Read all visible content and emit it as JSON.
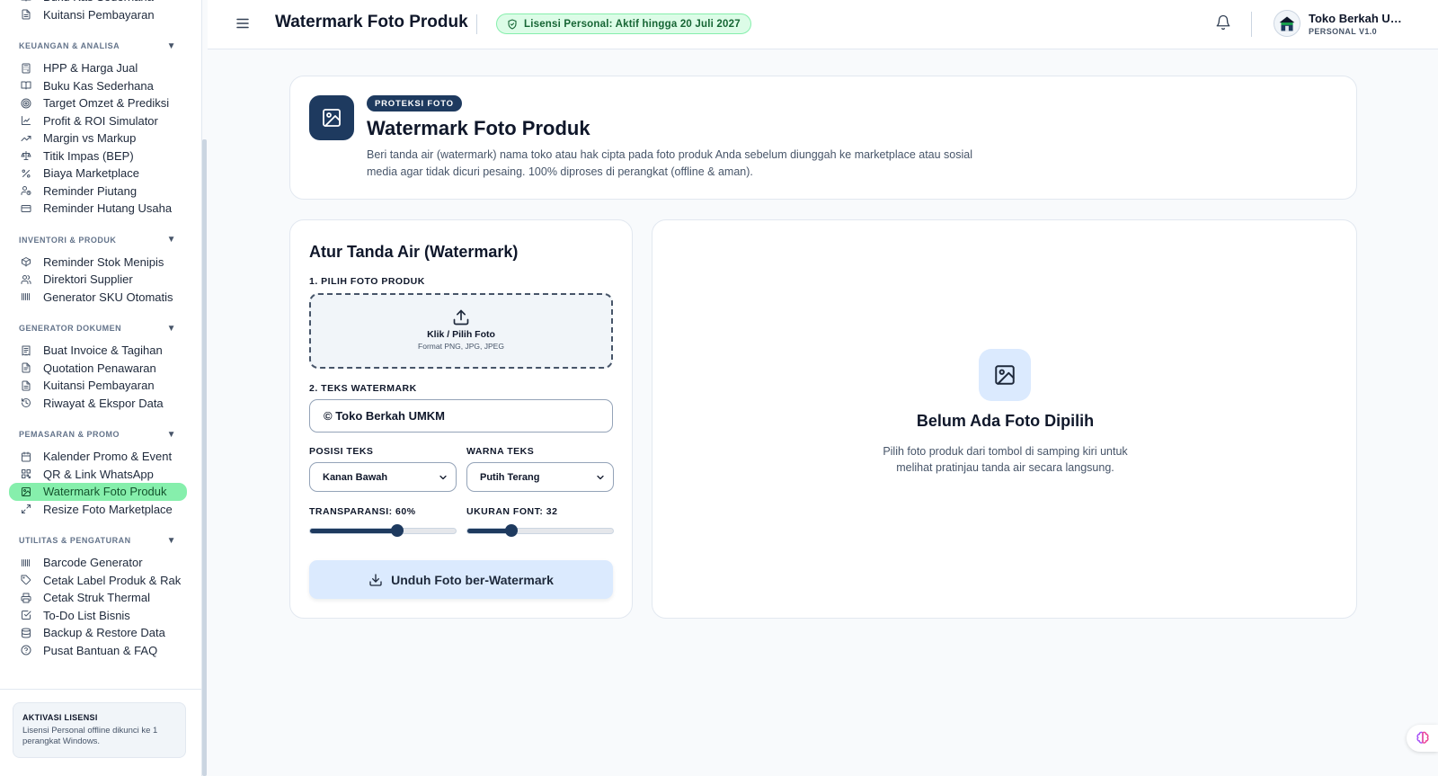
{
  "sidebar": {
    "top_items": [
      {
        "label": "Buku Kas Sederhana",
        "icon": "book-open-icon"
      },
      {
        "label": "Kuitansi Pembayaran",
        "icon": "file-text-icon"
      }
    ],
    "sections": [
      {
        "title": "KEUANGAN & ANALISA",
        "items": [
          {
            "label": "HPP & Harga Jual",
            "icon": "calculator-icon"
          },
          {
            "label": "Buku Kas Sederhana",
            "icon": "book-open-icon"
          },
          {
            "label": "Target Omzet & Prediksi",
            "icon": "target-icon"
          },
          {
            "label": "Profit & ROI Simulator",
            "icon": "line-chart-icon"
          },
          {
            "label": "Margin vs Markup",
            "icon": "trending-up-icon"
          },
          {
            "label": "Titik Impas (BEP)",
            "icon": "scale-icon"
          },
          {
            "label": "Biaya Marketplace",
            "icon": "percent-icon"
          },
          {
            "label": "Reminder Piutang",
            "icon": "user-clock-icon"
          },
          {
            "label": "Reminder Hutang Usaha",
            "icon": "credit-card-icon"
          }
        ]
      },
      {
        "title": "INVENTORI & PRODUK",
        "items": [
          {
            "label": "Reminder Stok Menipis",
            "icon": "package-icon"
          },
          {
            "label": "Direktori Supplier",
            "icon": "users-icon"
          },
          {
            "label": "Generator SKU Otomatis",
            "icon": "barcode-icon"
          }
        ]
      },
      {
        "title": "GENERATOR DOKUMEN",
        "items": [
          {
            "label": "Buat Invoice & Tagihan",
            "icon": "invoice-icon"
          },
          {
            "label": "Quotation Penawaran",
            "icon": "file-list-icon"
          },
          {
            "label": "Kuitansi Pembayaran",
            "icon": "file-text-icon"
          },
          {
            "label": "Riwayat & Ekspor Data",
            "icon": "history-icon"
          }
        ]
      },
      {
        "title": "PEMASARAN & PROMO",
        "items": [
          {
            "label": "Kalender Promo & Event",
            "icon": "calendar-icon"
          },
          {
            "label": "QR & Link WhatsApp",
            "icon": "qr-code-icon"
          },
          {
            "label": "Watermark Foto Produk",
            "icon": "image-icon",
            "active": true
          },
          {
            "label": "Resize Foto Marketplace",
            "icon": "maximize-icon"
          }
        ]
      },
      {
        "title": "UTILITAS & PENGATURAN",
        "items": [
          {
            "label": "Barcode Generator",
            "icon": "barcode-icon"
          },
          {
            "label": "Cetak Label Produk & Rak",
            "icon": "tag-icon"
          },
          {
            "label": "Cetak Struk Thermal",
            "icon": "printer-icon"
          },
          {
            "label": "To-Do List Bisnis",
            "icon": "check-square-icon"
          },
          {
            "label": "Backup & Restore Data",
            "icon": "database-icon"
          },
          {
            "label": "Pusat Bantuan & FAQ",
            "icon": "help-circle-icon"
          }
        ]
      }
    ],
    "license": {
      "title": "AKTIVASI LISENSI",
      "desc": "Lisensi Personal offline dikunci ke 1 perangkat Windows."
    }
  },
  "topbar": {
    "title": "Watermark Foto Produk",
    "license_badge": "Lisensi Personal: Aktif hingga 20 Juli 2027",
    "shop_name": "Toko Berkah UMKM",
    "plan": "PERSONAL V1.0"
  },
  "hero": {
    "tag": "PROTEKSI FOTO",
    "title": "Watermark Foto Produk",
    "desc": "Beri tanda air (watermark) nama toko atau hak cipta pada foto produk Anda sebelum diunggah ke marketplace atau sosial media agar tidak dicuri pesaing. 100% diproses di perangkat (offline & aman)."
  },
  "form": {
    "title": "Atur Tanda Air (Watermark)",
    "step1_label": "1. PILIH FOTO PRODUK",
    "upload_title": "Klik / Pilih Foto",
    "upload_formats": "Format PNG, JPG, JPEG",
    "step2_label": "2. TEKS WATERMARK",
    "watermark_value": "© Toko Berkah UMKM",
    "position_label": "POSISI TEKS",
    "position_value": "Kanan Bawah",
    "color_label": "WARNA TEKS",
    "color_value": "Putih Terang",
    "opacity_label": "TRANSPARANSI: 60%",
    "opacity_value": 60,
    "fontsize_label": "UKURAN FONT: 32",
    "fontsize_fraction": 0.3,
    "download_label": "Unduh Foto ber-Watermark"
  },
  "preview": {
    "title": "Belum Ada Foto Dipilih",
    "desc": "Pilih foto produk dari tombol di samping kiri untuk melihat pratinjau tanda air secara langsung."
  },
  "colors": {
    "primary": "#1e3a5f",
    "active_nav": "#86efac",
    "license_badge_bg": "#dcfce7",
    "license_badge_text": "#166534"
  }
}
